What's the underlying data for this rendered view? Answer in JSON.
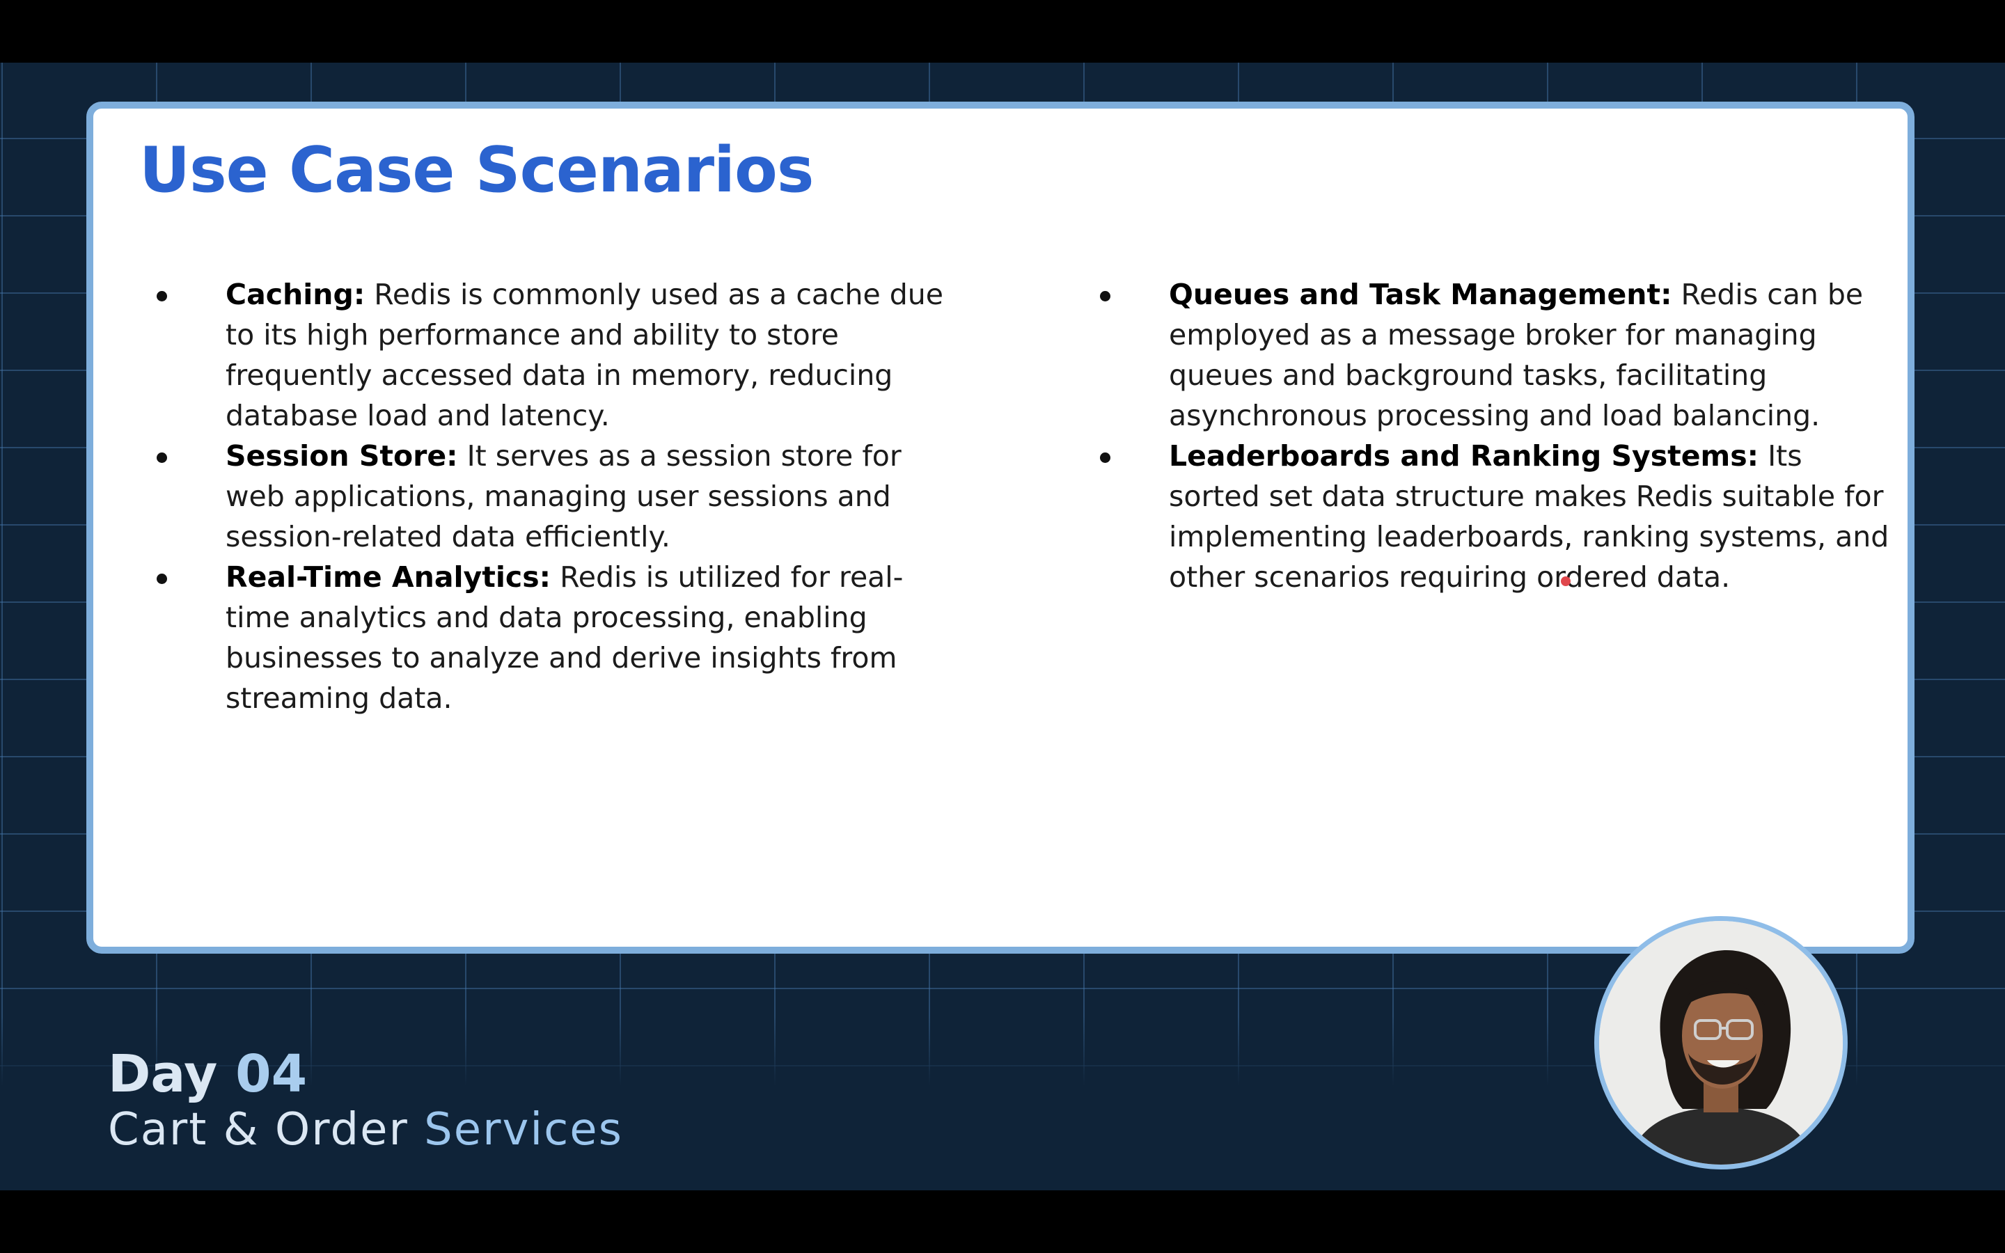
{
  "slide": {
    "title": "Use Case Scenarios",
    "left_bullets": [
      {
        "heading": "Caching:",
        "text": " Redis is commonly used as a cache due to its high performance and ability to store frequently accessed data in memory, reducing database load and latency."
      },
      {
        "heading": "Session Store:",
        "text": " It serves as a session store for web applications, managing user sessions and session-related data efficiently."
      },
      {
        "heading": "Real-Time Analytics:",
        "text": " Redis is utilized for real-time analytics and data processing, enabling businesses to analyze and derive insights from streaming data."
      }
    ],
    "right_bullets": [
      {
        "heading": "Queues and Task Management:",
        "text": " Redis can be employed as a message broker for managing queues and background tasks, facilitating asynchronous processing and load balancing."
      },
      {
        "heading": "Leaderboards and Ranking Systems:",
        "text": " Its sorted set data structure makes Redis suitable for implementing leaderboards, ranking systems, and other scenarios requiring ordered data."
      }
    ]
  },
  "footer": {
    "day_label": "Day",
    "day_number": "04",
    "subtitle_main": "Cart & Order ",
    "subtitle_accent": "Services"
  },
  "colors": {
    "title": "#2b63cf",
    "background": "#0f2338",
    "slide_border": "#7eaedc",
    "pointer": "#e0474c"
  },
  "icons": {
    "presenter": "presenter-avatar",
    "pointer": "laser-pointer-dot"
  }
}
